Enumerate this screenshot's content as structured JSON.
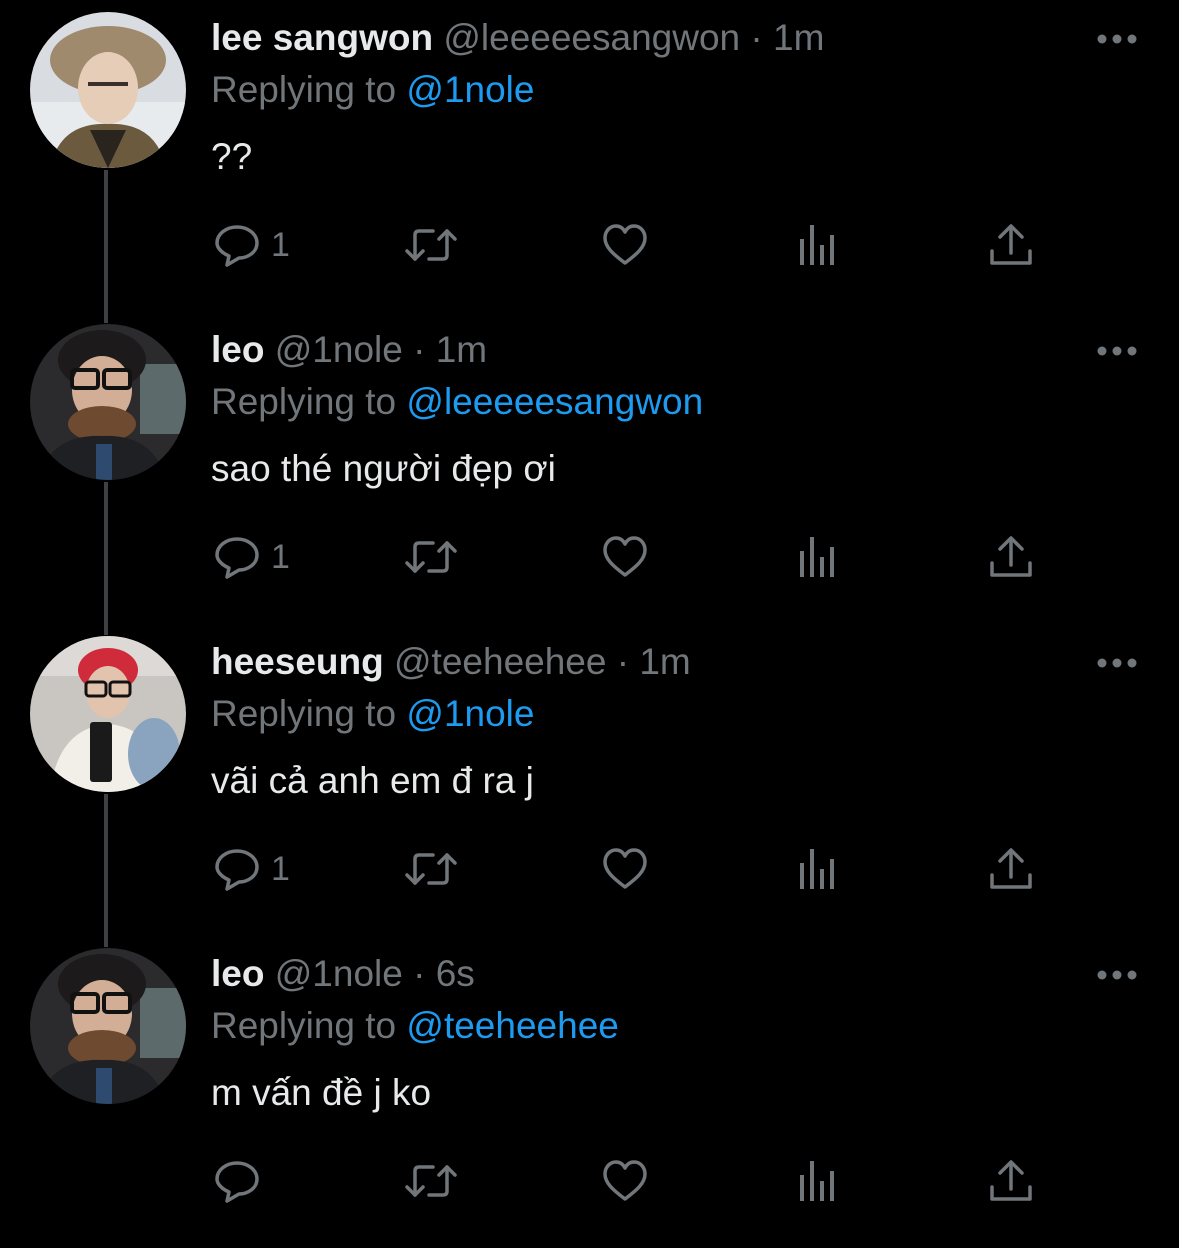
{
  "colors": {
    "background": "#000000",
    "text_primary": "#e7e9ea",
    "text_secondary": "#71767b",
    "mention": "#1d9bf0",
    "thread_line": "#3e4144"
  },
  "tweets": [
    {
      "display_name": "lee sangwon",
      "handle": "@leeeeesangwon",
      "separator": "·",
      "time": "1m",
      "replying_prefix": "Replying to",
      "replying_to": "@1nole",
      "text": "??",
      "reply_count": "1",
      "avatar": "avatar-photo-fur-hat"
    },
    {
      "display_name": "leo",
      "handle": "@1nole",
      "separator": "·",
      "time": "1m",
      "replying_prefix": "Replying to",
      "replying_to": "@leeeeesangwon",
      "text": "sao thé người đẹp ơi",
      "reply_count": "1",
      "avatar": "avatar-photo-glasses"
    },
    {
      "display_name": "heeseung",
      "handle": "@teeheehee",
      "separator": "·",
      "time": "1m",
      "replying_prefix": "Replying to",
      "replying_to": "@1nole",
      "text": "vãi cả anh em đ ra j",
      "reply_count": "1",
      "avatar": "avatar-photo-red-hair"
    },
    {
      "display_name": "leo",
      "handle": "@1nole",
      "separator": "·",
      "time": "6s",
      "replying_prefix": "Replying to",
      "replying_to": "@teeheehee",
      "text": "m vấn đề j ko",
      "reply_count": "",
      "avatar": "avatar-photo-glasses"
    }
  ],
  "icons": {
    "reply": "reply-bubble-icon",
    "retweet": "retweet-icon",
    "like": "heart-icon",
    "views": "analytics-bars-icon",
    "share": "share-upload-icon",
    "more": "more-dots-icon"
  }
}
